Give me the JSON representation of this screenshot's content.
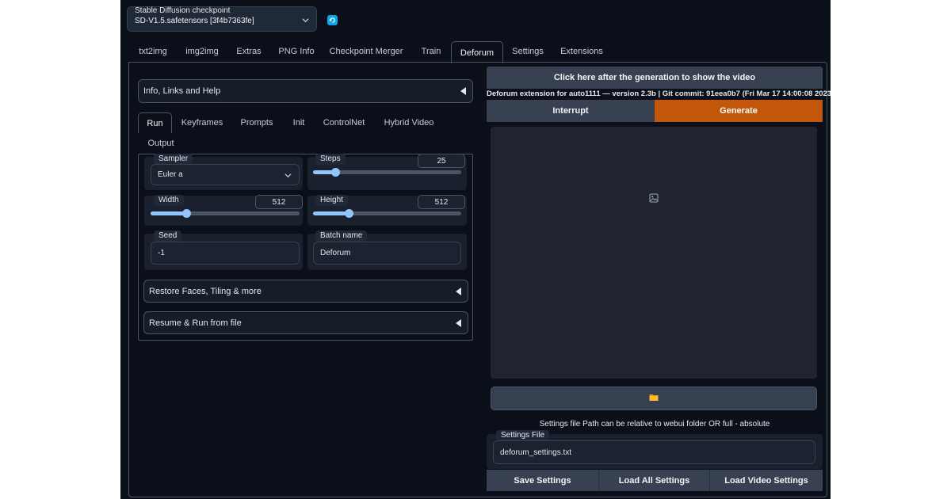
{
  "checkpoint": {
    "label": "Stable Diffusion checkpoint",
    "value": "SD-V1.5.safetensors [3f4b7363fe]",
    "refresh_icon": "refresh-icon",
    "chevron_icon": "chevron-down-icon"
  },
  "main_tabs": [
    {
      "label": "txt2img"
    },
    {
      "label": "img2img"
    },
    {
      "label": "Extras"
    },
    {
      "label": "PNG Info"
    },
    {
      "label": "Checkpoint Merger"
    },
    {
      "label": "Train"
    },
    {
      "label": "Deforum",
      "active": true
    },
    {
      "label": "Settings"
    },
    {
      "label": "Extensions"
    }
  ],
  "left": {
    "info_accordion": "Info, Links and Help",
    "sub_tabs": [
      {
        "label": "Run",
        "active": true
      },
      {
        "label": "Keyframes"
      },
      {
        "label": "Prompts"
      },
      {
        "label": "Init"
      },
      {
        "label": "ControlNet"
      },
      {
        "label": "Hybrid Video"
      },
      {
        "label": "Output"
      }
    ],
    "sampler": {
      "label": "Sampler",
      "value": "Euler a"
    },
    "steps": {
      "label": "Steps",
      "value": "25",
      "fraction": 0.15
    },
    "width": {
      "label": "Width",
      "value": "512",
      "fraction": 0.24
    },
    "height": {
      "label": "Height",
      "value": "512",
      "fraction": 0.24
    },
    "seed": {
      "label": "Seed",
      "value": "-1"
    },
    "batch_name": {
      "label": "Batch name",
      "value": "Deforum"
    },
    "restore_accordion": "Restore Faces, Tiling & more",
    "resume_accordion": "Resume & Run from file"
  },
  "right": {
    "show_video_button": "Click here after the generation to show the video",
    "version_text": "Deforum extension for auto1111 — version 2.3b | Git commit: 91eea0b7 (Fri Mar 17 14:00:08 2023)",
    "interrupt_button": "Interrupt",
    "generate_button": "Generate",
    "image_placeholder_icon": "image-icon",
    "folder_icon": "folder-icon",
    "settings_path_note": "Settings file Path can be relative to webui folder OR full - absolute",
    "settings_file": {
      "label": "Settings File",
      "value": "deforum_settings.txt"
    },
    "save_settings": "Save Settings",
    "load_all_settings": "Load All Settings",
    "load_video_settings": "Load Video Settings"
  },
  "colors": {
    "background": "#0b0f19",
    "generate_orange": "#c2560b",
    "slider_blue": "#93c5fd",
    "refresh_blue": "#0ea5e9"
  }
}
